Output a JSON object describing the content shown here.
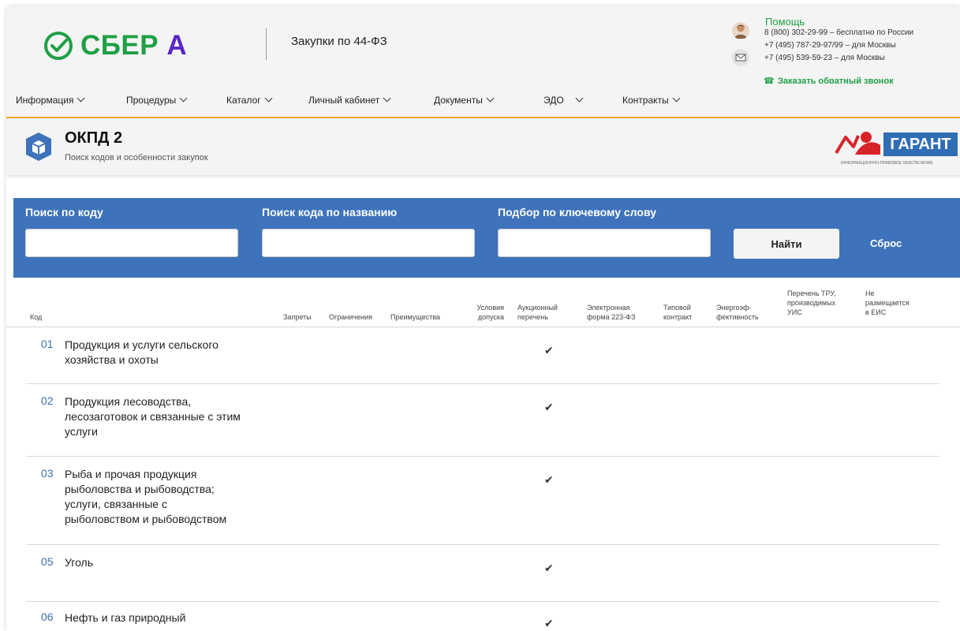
{
  "header": {
    "logo_text": "СБЕР",
    "logo_accent": "А",
    "site_title": "Закупки по 44-ФЗ",
    "help": {
      "title": "Помощь",
      "lines": [
        "8 (800) 302-29-99 – бесплатно по России",
        "+7 (495) 787-29-97/99 – для Москвы",
        "+7 (495) 539-59-23 – для Москвы"
      ],
      "callback": "Заказать обратный звонок"
    }
  },
  "nav": {
    "items": [
      "Информация",
      "Процедуры",
      "Каталог",
      "Личный кабинет",
      "Документы",
      "ЭДО",
      "Контракты"
    ]
  },
  "section": {
    "title": "ОКПД 2",
    "subtitle": "Поиск кодов и особенности закупок",
    "partner_logo": "ГАРАНТ",
    "partner_tagline": "ИНФОРМАЦИОННО-ПРАВОВОЕ ОБЕСПЕЧЕНИЕ"
  },
  "search": {
    "by_code_label": "Поиск по коду",
    "by_name_label": "Поиск кода по названию",
    "by_keyword_label": "Подбор по ключевому слову",
    "by_code_value": "",
    "by_name_value": "",
    "by_keyword_value": "",
    "find_label": "Найти",
    "reset_label": "Сброс"
  },
  "table": {
    "columns": {
      "code": "Код",
      "bans": "Запреты",
      "restrictions": "Ограничения",
      "advantages": "Преимущества",
      "admission_1": "Условия",
      "admission_2": "допуска",
      "auction_1": "Аукционный",
      "auction_2": "перечень",
      "eform_1": "Электронная",
      "eform_2": "форма 223-ФЗ",
      "typical_1": "Типовой",
      "typical_2": "контракт",
      "energy_1": "Энергоэф-",
      "energy_2": "фективность",
      "uis_1": "Перечень ТРУ,",
      "uis_2": "производимых",
      "uis_3": "УИС",
      "eis_1": "Не",
      "eis_2": "размещается",
      "eis_3": "в ЕИС"
    },
    "rows": [
      {
        "code": "01",
        "lines": [
          "Продукция и услуги сельского",
          "хозяйства и охоты"
        ],
        "auction": "✔"
      },
      {
        "code": "02",
        "lines": [
          "Продукция лесоводства,",
          "лесозаготовок и связанные с этим",
          "услуги"
        ],
        "auction": "✔"
      },
      {
        "code": "03",
        "lines": [
          "Рыба и прочая продукция",
          "рыболовства и рыбоводства;",
          "услуги, связанные с",
          "рыболовством и рыбоводством"
        ],
        "auction": "✔"
      },
      {
        "code": "05",
        "lines": [
          "Уголь"
        ],
        "auction": "✔"
      },
      {
        "code": "06",
        "lines": [
          "Нефть и газ природный"
        ],
        "auction": "✔"
      }
    ]
  },
  "colors": {
    "brand_green": "#1f9f45",
    "brand_purple": "#5a27c8",
    "search_blue": "#3e73bb",
    "nav_accent": "#f5a623",
    "code_link": "#3e6fb0"
  }
}
